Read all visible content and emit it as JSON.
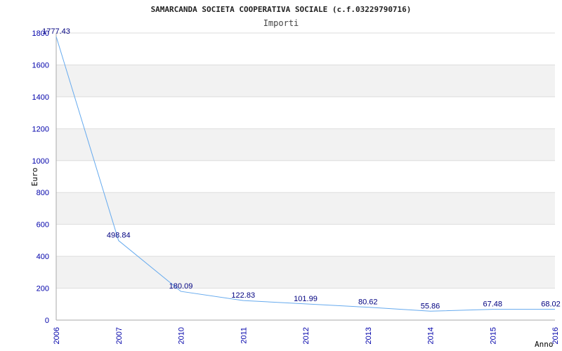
{
  "chart_data": {
    "type": "line",
    "title": "SAMARCANDA SOCIETA COOPERATIVA SOCIALE (c.f.03229790716)",
    "subtitle": "Importi",
    "xlabel": "Anno",
    "ylabel": "Euro",
    "categories": [
      "2006",
      "2007",
      "2010",
      "2011",
      "2012",
      "2013",
      "2014",
      "2015",
      "2016"
    ],
    "values": [
      1777.43,
      498.84,
      180.09,
      122.83,
      101.99,
      80.62,
      55.86,
      67.48,
      68.02
    ],
    "value_labels": [
      "1777.43",
      "498.84",
      "180.09",
      "122.83",
      "101.99",
      "80.62",
      "55.86",
      "67.48",
      "68.02"
    ],
    "ylim": [
      0,
      1800
    ],
    "yticks": [
      0,
      200,
      400,
      600,
      800,
      1000,
      1200,
      1400,
      1600,
      1800
    ],
    "grid": true,
    "legend": "none",
    "colors": {
      "line": "#66aaee",
      "band": "#f2f2f2",
      "grid": "#dddddd",
      "tick_text": "#0000aa",
      "label_text": "#000080"
    }
  }
}
